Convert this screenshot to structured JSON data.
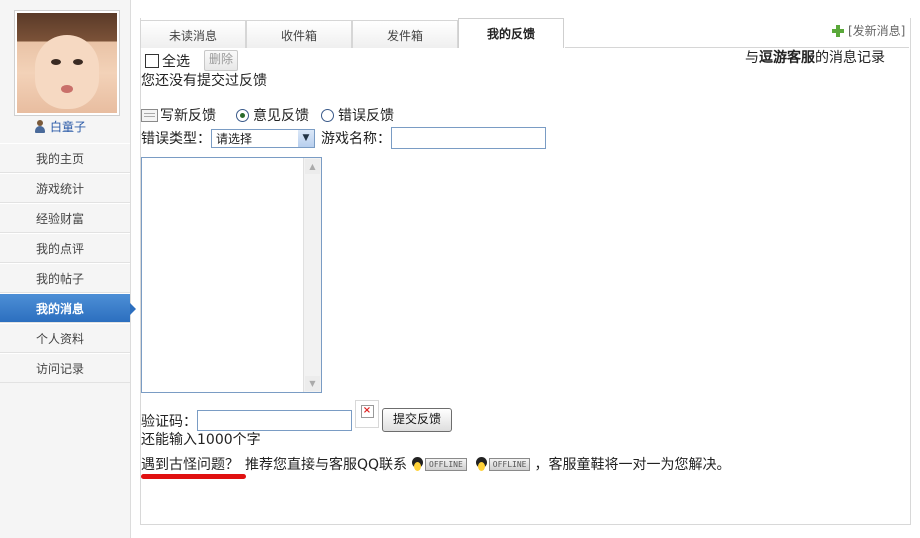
{
  "sidebar": {
    "username": "白童子",
    "items": [
      {
        "label": "我的主页"
      },
      {
        "label": "游戏统计"
      },
      {
        "label": "经验财富"
      },
      {
        "label": "我的点评"
      },
      {
        "label": "我的帖子"
      },
      {
        "label": "我的消息",
        "active": true
      },
      {
        "label": "个人资料"
      },
      {
        "label": "访问记录"
      }
    ]
  },
  "tabs": [
    "未读消息",
    "收件箱",
    "发件箱",
    "我的反馈"
  ],
  "active_tab": "我的反馈",
  "new_message": "[发新消息]",
  "record": {
    "prefix": "与",
    "name": "逗游客服",
    "suffix": "的消息记录"
  },
  "select_all": "全选",
  "delete_button": "删除",
  "no_feedback": "您还没有提交过反馈",
  "write_feedback": "写新反馈",
  "radio_opinion": "意见反馈",
  "radio_error": "错误反馈",
  "error_type_label": "错误类型：",
  "error_type_value": "请选择",
  "game_name_label": "游戏名称：",
  "captcha_label": "验证码：",
  "submit_button": "提交反馈",
  "remaining": "还能输入1000个字",
  "problem_link": "遇到古怪问题？",
  "help_text": "推荐您直接与客服QQ联系",
  "offline_label": "OFFLINE",
  "help_suffix": "，客服童鞋将一对一为您解决。",
  "colors": {
    "accent": "#2c6fbf",
    "highlight": "#e01010"
  }
}
